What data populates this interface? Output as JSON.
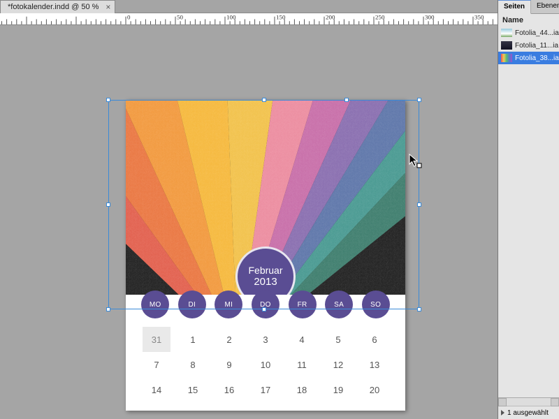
{
  "document": {
    "tab_title": "*fotokalender.indd @ 50 %"
  },
  "ruler": {
    "major_ticks": [
      0,
      50,
      100,
      150,
      200,
      250
    ]
  },
  "calendar": {
    "month": "Februar",
    "year": "2013",
    "weekdays": [
      "MO",
      "DI",
      "MI",
      "DO",
      "FR",
      "SA",
      "SO"
    ],
    "rows": [
      [
        {
          "v": "31",
          "prev": true
        },
        {
          "v": "1"
        },
        {
          "v": "2"
        },
        {
          "v": "3"
        },
        {
          "v": "4"
        },
        {
          "v": "5"
        },
        {
          "v": "6"
        }
      ],
      [
        {
          "v": "7"
        },
        {
          "v": "8"
        },
        {
          "v": "9"
        },
        {
          "v": "10"
        },
        {
          "v": "11"
        },
        {
          "v": "12"
        },
        {
          "v": "13"
        }
      ],
      [
        {
          "v": "14"
        },
        {
          "v": "15"
        },
        {
          "v": "16"
        },
        {
          "v": "17"
        },
        {
          "v": "18"
        },
        {
          "v": "19"
        },
        {
          "v": "20"
        }
      ]
    ]
  },
  "panel": {
    "tabs": {
      "pages": "Seiten",
      "layers": "Ebenen"
    },
    "column_header": "Name",
    "items": [
      {
        "label": "Fotolia_44...ia"
      },
      {
        "label": "Fotolia_11...ia"
      },
      {
        "label": "Fotolia_38...ia"
      }
    ],
    "status": "1 ausgewählt"
  },
  "colors": {
    "accent": "#5a4d93",
    "selection": "#3a8ad8"
  }
}
